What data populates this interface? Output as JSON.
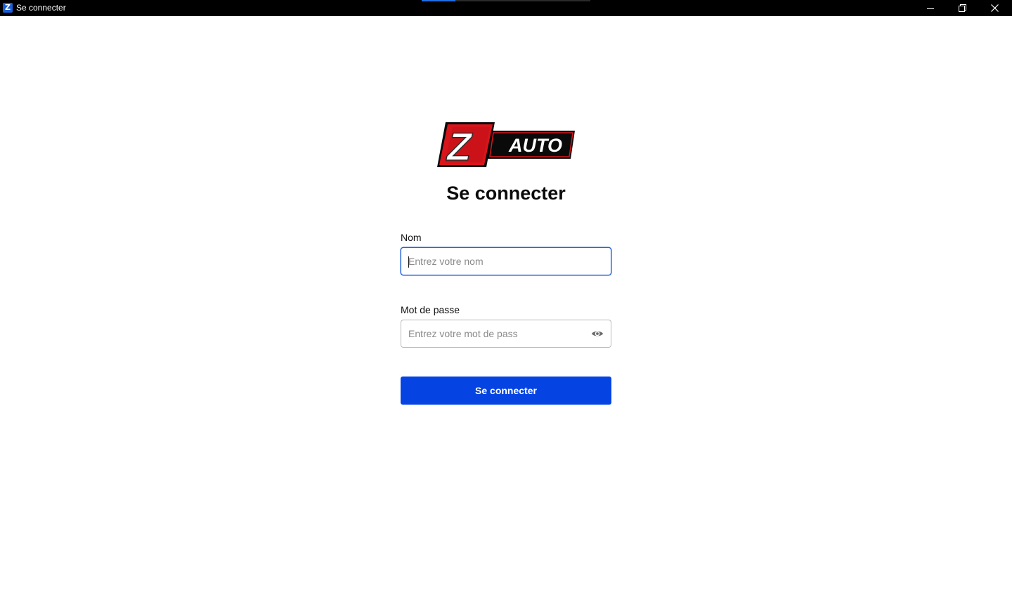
{
  "window": {
    "app_icon_letter": "Z",
    "title": "Se connecter",
    "loading_progress": 0.2,
    "controls": [
      "minimize-icon",
      "restore-icon",
      "close-icon"
    ]
  },
  "brand": {
    "logo_letter": "Z",
    "logo_text": "AUTO",
    "colors": {
      "red": "#d8151b",
      "black": "#0a0a0a"
    }
  },
  "login": {
    "heading": "Se connecter",
    "name_label": "Nom",
    "name_placeholder": "Entrez votre nom",
    "name_value": "",
    "password_label": "Mot de passe",
    "password_placeholder": "Entrez votre mot de pass",
    "password_value": "",
    "password_toggle_icon": "eye-icon",
    "submit_label": "Se connecter"
  },
  "colors": {
    "accent": "#0544e3",
    "focus_border": "#2563d9"
  }
}
